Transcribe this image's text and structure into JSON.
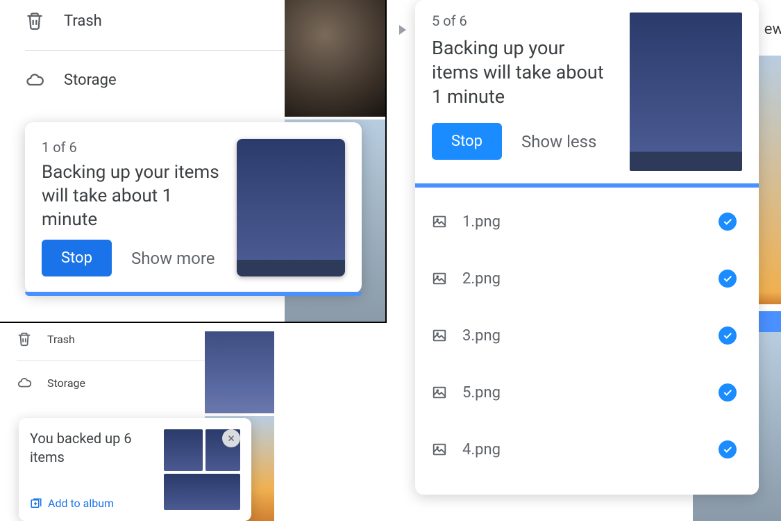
{
  "panel1": {
    "nav": {
      "trash": "Trash",
      "storage": "Storage"
    },
    "toast": {
      "count": "1 of 6",
      "message": "Backing up your items will take about 1 minute",
      "stop": "Stop",
      "expand": "Show more"
    }
  },
  "panel2": {
    "ew_text": "ew",
    "toast": {
      "count": "5 of 6",
      "message": "Backing up your items will take about 1 minute",
      "stop": "Stop",
      "collapse": "Show less",
      "files": [
        {
          "name": "1.png",
          "done": true
        },
        {
          "name": "2.png",
          "done": true
        },
        {
          "name": "3.png",
          "done": true
        },
        {
          "name": "5.png",
          "done": true
        },
        {
          "name": "4.png",
          "done": true
        }
      ]
    }
  },
  "panel3": {
    "nav": {
      "trash": "Trash",
      "storage": "Storage"
    },
    "toast": {
      "message": "You backed up 6 items",
      "action": "Add to album"
    }
  }
}
